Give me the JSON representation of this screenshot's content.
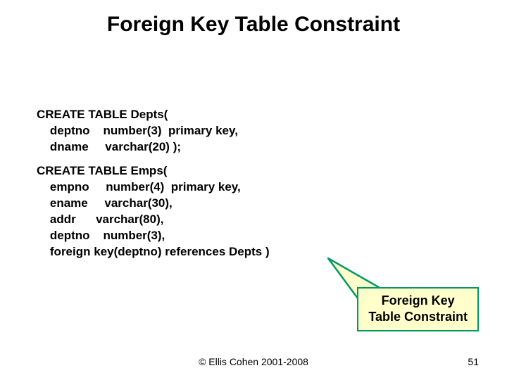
{
  "title": "Foreign Key Table Constraint",
  "code1": "CREATE TABLE Depts(\n    deptno    number(3)  primary key,\n    dname     varchar(20) );",
  "code2": "CREATE TABLE Emps(\n    empno     number(4)  primary key,\n    ename     varchar(30),\n    addr      varchar(80),\n    deptno    number(3),\n    foreign key(deptno) references Depts )",
  "callout": {
    "line1": "Foreign Key",
    "line2": "Table Constraint"
  },
  "footer": {
    "copyright": "© Ellis Cohen 2001-2008",
    "page": "51"
  }
}
